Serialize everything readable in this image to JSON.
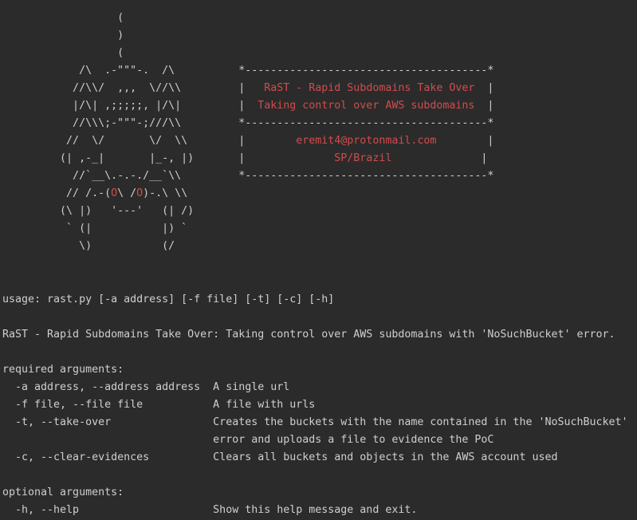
{
  "ascii_art": {
    "lines": [
      "                  (",
      "                  )",
      "                  (",
      "            /\\  .-\"\"\"-.  /\\          *--------------------------------------*",
      "           //\\\\/  ,,,  \\//\\\\         |   ",
      "           |/\\| ,;;;;;, |/\\|         |  ",
      "           //\\\\\\;-\"\"\"-;///\\\\         *--------------------------------------*",
      "          //  \\/       \\/  \\\\        |        ",
      "         (| ,-_|       |_-, |)       |              ",
      "           //`__\\.-.-./__`\\\\         *--------------------------------------*",
      "          // /.-(",
      "         (\\ |)   '---'   (| /)",
      "          ` (|           |) `",
      "            \\)           (/"
    ],
    "red_segments": {
      "l4_text": "RaST - Rapid Subdomains Take Over",
      "l4_tail": "  |",
      "l5_text": "Taking control over AWS subdomains",
      "l5_tail": "  |",
      "l7_text": "eremit4@protonmail.com",
      "l7_tail": "        |",
      "l8_text": "SP/Brazil",
      "l8_tail": "              |",
      "l10_o1": "O",
      "l10_mid": "\\ /",
      "l10_o2": "O",
      "l10_tail": ")-.\\ \\\\"
    }
  },
  "help": {
    "usage": "usage: rast.py [-a address] [-f file] [-t] [-c] [-h]",
    "description": "RaST - Rapid Subdomains Take Over: Taking control over AWS subdomains with 'NoSuchBucket' error.",
    "required_header": "required arguments:",
    "required": [
      "  -a address, --address address  A single url",
      "  -f file, --file file           A file with urls",
      "  -t, --take-over                Creates the buckets with the name contained in the 'NoSuchBucket'",
      "                                 error and uploads a file to evidence the PoC",
      "  -c, --clear-evidences          Clears all buckets and objects in the AWS account used"
    ],
    "optional_header": "optional arguments:",
    "optional": [
      "  -h, --help                     Show this help message and exit."
    ]
  },
  "colors": {
    "background": "#2b2b2b",
    "text": "#cdcfd1",
    "accent_red": "#d44b4b"
  }
}
